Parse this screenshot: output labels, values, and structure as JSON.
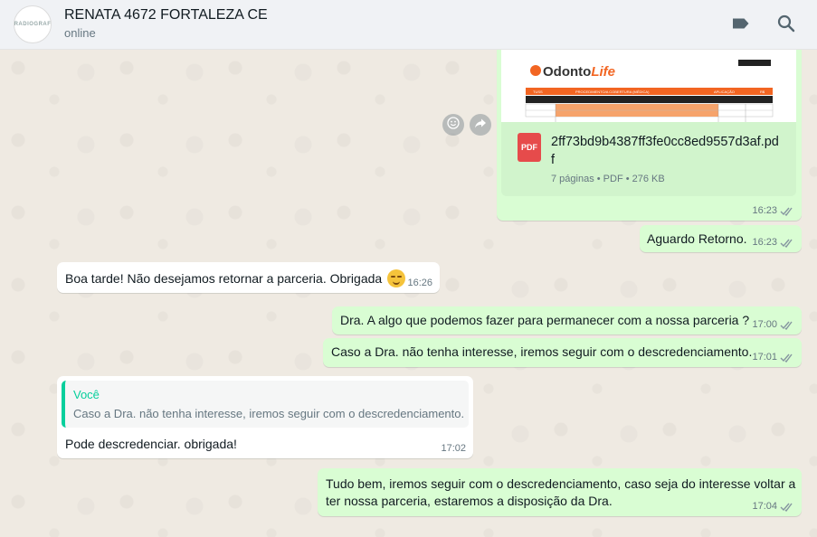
{
  "header": {
    "contact_name": "RENATA 4672 FORTALEZA CE",
    "status": "online",
    "avatar_text": "RADIOGRAF"
  },
  "icons": {
    "label": "label-icon",
    "search": "search-icon",
    "emoji_action": "emoji-icon",
    "forward": "forward-icon"
  },
  "preview": {
    "logo_text": "OdontoLife",
    "table_cols": [
      "TUSS",
      "PROCEDIMENTO/A COBERTURA (MÉDICA)",
      "APLICAÇÃO",
      "R$"
    ]
  },
  "messages": [
    {
      "id": "m1",
      "direction": "out",
      "type": "document",
      "file_name": "2ff73bd9b4387ff3fe0cc8ed9557d3af.pdf",
      "file_badge": "PDF",
      "file_info": "7 páginas • PDF • 276 KB",
      "time": "16:23"
    },
    {
      "id": "m2",
      "direction": "out",
      "text": "Aguardo Retorno.",
      "time": "16:23"
    },
    {
      "id": "m3",
      "direction": "in",
      "text": "Boa tarde! Não desejamos retornar a parceria. Obrigada",
      "time": "16:26"
    },
    {
      "id": "m4",
      "direction": "out",
      "text": "Dra. A algo que podemos fazer para permanecer com a nossa parceria ?",
      "time": "17:00"
    },
    {
      "id": "m5",
      "direction": "out",
      "text": "Caso a Dra. não tenha interesse, iremos seguir com o descredenciamento.",
      "time": "17:01"
    },
    {
      "id": "m6",
      "direction": "in",
      "quote_author": "Você",
      "quote_text": "Caso a Dra. não tenha interesse, iremos seguir com o descredenciamento.",
      "text": "Pode descredenciar. obrigada!",
      "time": "17:02"
    },
    {
      "id": "m7",
      "direction": "out",
      "text_line1": "Tudo bem, iremos seguir com o descredenciamento, caso seja do interesse voltar a",
      "text_line2": "ter nossa parceria, estaremos a disposição da Dra.",
      "time": "17:04"
    }
  ],
  "colors": {
    "outgoing": "#d9fdd3",
    "incoming": "#ffffff",
    "accent": "#06cf9c",
    "read_ticks": "#8696a0"
  }
}
